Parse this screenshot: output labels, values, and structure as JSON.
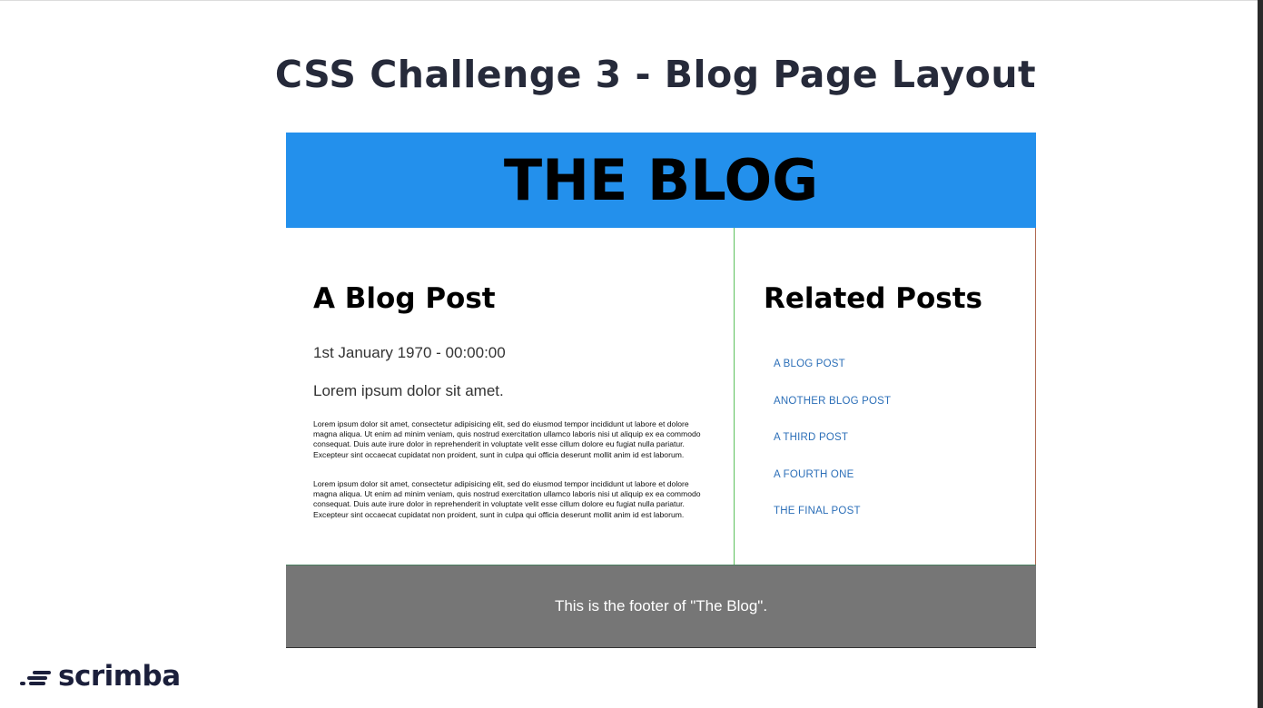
{
  "slide": {
    "title": "CSS Challenge 3 - Blog Page Layout"
  },
  "blog": {
    "header_title": "THE BLOG",
    "post": {
      "title": "A Blog Post",
      "date": "1st January 1970 - 00:00:00",
      "lead": "Lorem ipsum dolor sit amet.",
      "paragraphs": [
        "Lorem ipsum dolor sit amet, consectetur adipisicing elit, sed do eiusmod tempor incididunt ut labore et dolore magna aliqua. Ut enim ad minim veniam, quis nostrud exercitation ullamco laboris nisi ut aliquip ex ea commodo consequat. Duis aute irure dolor in reprehenderit in voluptate velit esse cillum dolore eu fugiat nulla pariatur. Excepteur sint occaecat cupidatat non proident, sunt in culpa qui officia deserunt mollit anim id est laborum.",
        "Lorem ipsum dolor sit amet, consectetur adipisicing elit, sed do eiusmod tempor incididunt ut labore et dolore magna aliqua. Ut enim ad minim veniam, quis nostrud exercitation ullamco laboris nisi ut aliquip ex ea commodo consequat. Duis aute irure dolor in reprehenderit in voluptate velit esse cillum dolore eu fugiat nulla pariatur. Excepteur sint occaecat cupidatat non proident, sunt in culpa qui officia deserunt mollit anim id est laborum."
      ]
    },
    "related": {
      "title": "Related Posts",
      "links": [
        "A Blog Post",
        "Another Blog Post",
        "A Third Post",
        "A Fourth One",
        "The Final Post"
      ]
    },
    "footer_text": "This is the footer of \"The Blog\"."
  },
  "brand": {
    "logo_text": "scrimba"
  },
  "colors": {
    "header_bg": "#2390ec",
    "footer_bg": "#767676",
    "link": "#2c6fb8",
    "title_text": "#262a3a"
  }
}
